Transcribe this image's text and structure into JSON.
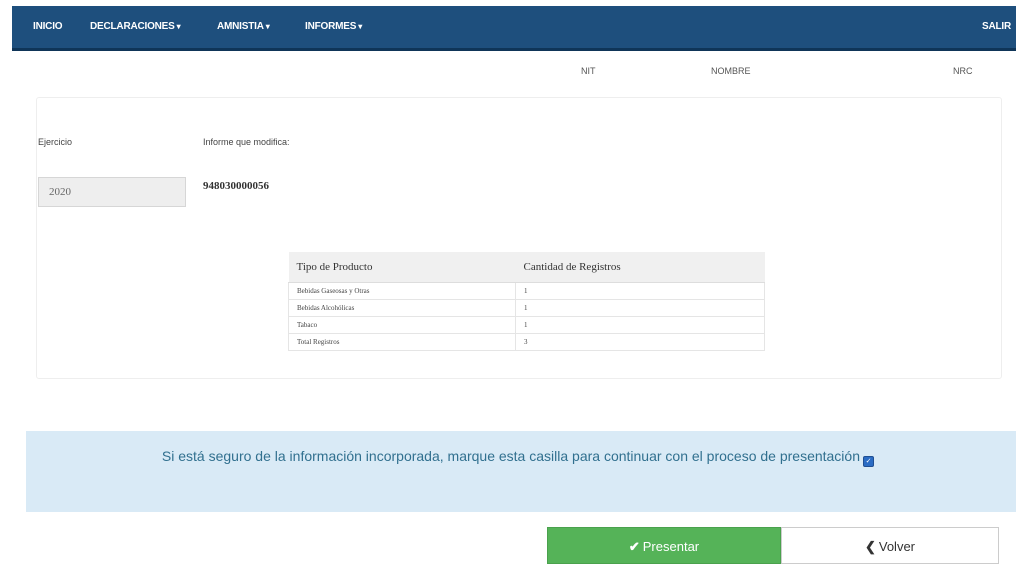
{
  "navbar": {
    "items": [
      "INICIO",
      "DECLARACIONES",
      "AMNISTIA",
      "INFORMES"
    ],
    "exit": "SALIR"
  },
  "info": {
    "nit_label": "NIT",
    "nombre_label": "NOMBRE",
    "nrc_label": "NRC"
  },
  "form": {
    "ejercicio_label": "Ejercicio",
    "ejercicio_value": "2020",
    "informe_label": "Informe que modifica:",
    "informe_value": "948030000056"
  },
  "summary_table": {
    "headers": [
      "Tipo de Producto",
      "Cantidad de Registros"
    ],
    "rows": [
      [
        "Bebidas Gaseosas y Otras",
        "1"
      ],
      [
        "Bebidas Alcohólicas",
        "1"
      ],
      [
        "Tabaco",
        "1"
      ],
      [
        "Total Registros",
        "3"
      ]
    ]
  },
  "confirm": {
    "text": "Si está seguro de la información incorporada, marque esta casilla para continuar con el proceso de presentación",
    "checked": true
  },
  "buttons": {
    "present": "Presentar",
    "back": "Volver"
  },
  "colors": {
    "navbar": "#1e4f7d",
    "confirm_bg": "#d9eaf6",
    "present_btn": "#55b358"
  }
}
